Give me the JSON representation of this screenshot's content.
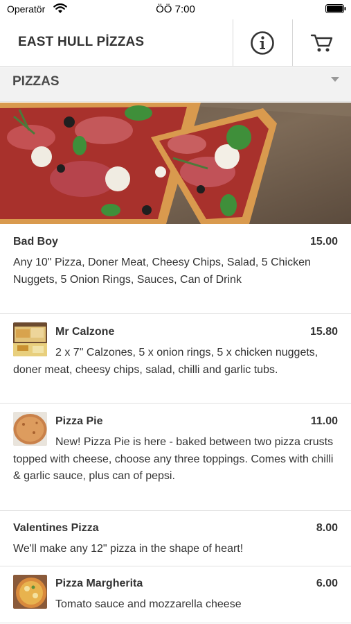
{
  "status_bar": {
    "carrier": "Operatör",
    "time": "ÖÖ 7:00"
  },
  "header": {
    "title": "EAST HULL PİZZAS",
    "icons": [
      "info-icon",
      "cart-icon"
    ]
  },
  "category": {
    "label": "PIZZAS",
    "icon": "chevron-down-icon"
  },
  "hero": {
    "icon": "pizza-photo"
  },
  "menu": {
    "items": [
      {
        "name": "Bad Boy",
        "price": "15.00",
        "description": "Any 10\" Pizza, Doner Meat, Cheesy Chips, Salad, 5 Chicken Nuggets, 5 Onion Rings, Sauces, Can of Drink",
        "has_image": false
      },
      {
        "name": "Mr Calzone",
        "price": "15.80",
        "description": "2 x 7\" Calzones, 5 x onion rings, 5 x chicken nuggets, doner meat, cheesy chips, salad, chilli and garlic tubs.",
        "has_image": true
      },
      {
        "name": "Pizza Pie",
        "price": "11.00",
        "description": "New! Pizza Pie is here - baked between two pizza crusts topped with cheese, choose any three toppings. Comes with chilli & garlic sauce, plus can of pepsi.",
        "has_image": true
      },
      {
        "name": "Valentines Pizza",
        "price": "8.00",
        "description": "We'll make any 12\" pizza in the shape of heart!",
        "has_image": false
      },
      {
        "name": "Pizza Margherita",
        "price": "6.00",
        "description": "Tomato sauce and mozzarella cheese",
        "has_image": true
      }
    ]
  }
}
